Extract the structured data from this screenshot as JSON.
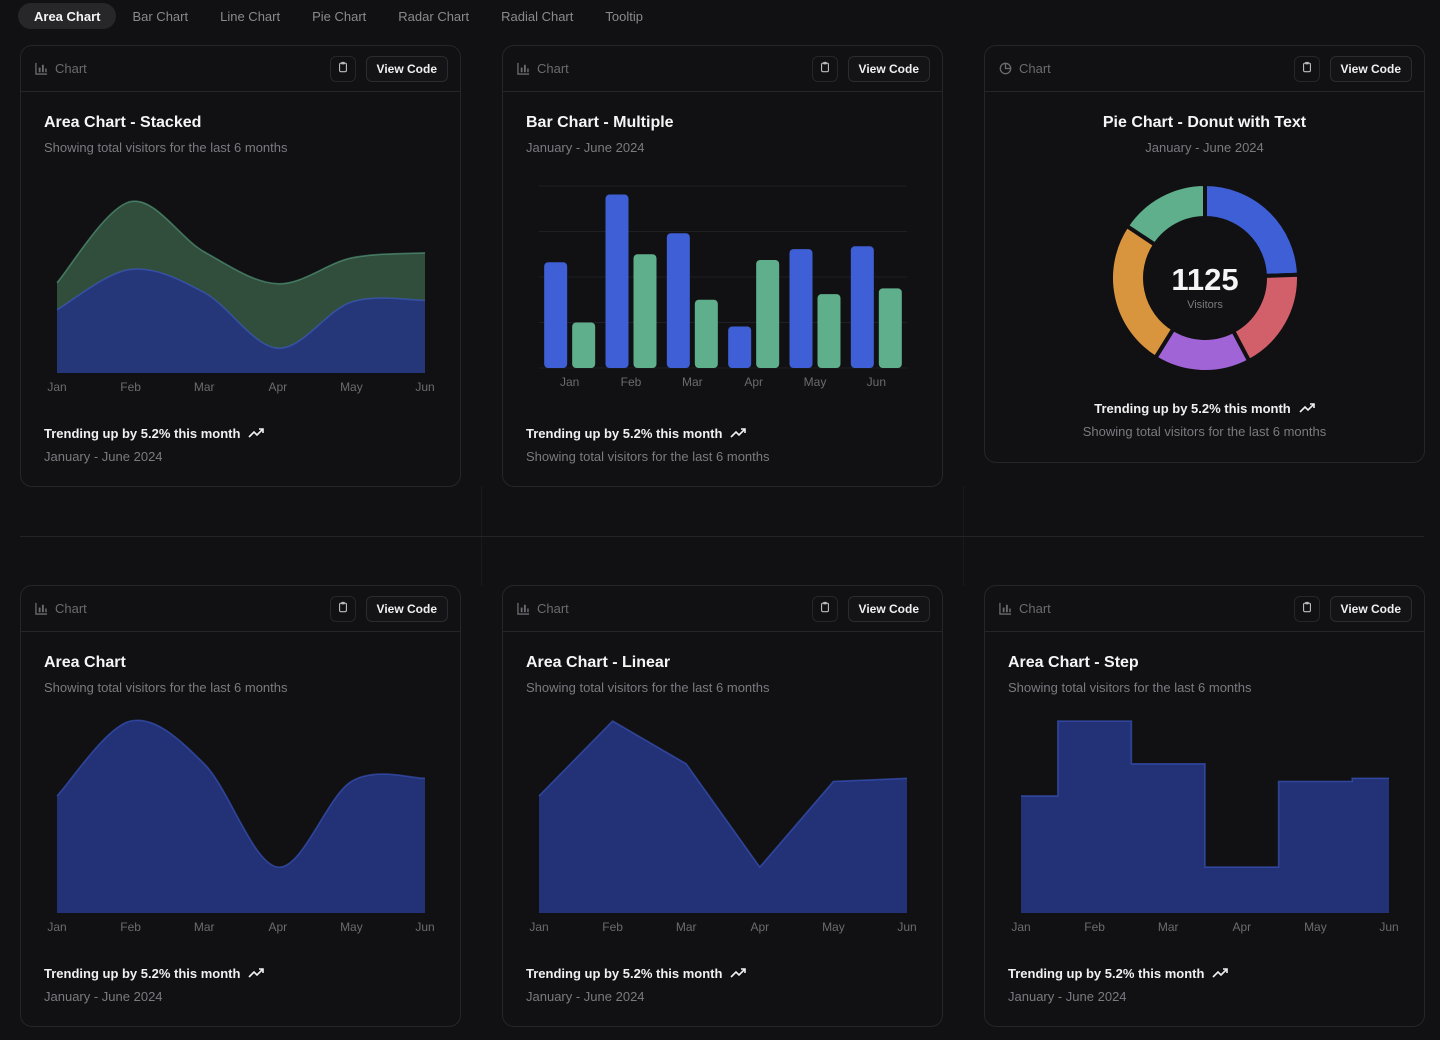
{
  "tabs": [
    "Area Chart",
    "Bar Chart",
    "Line Chart",
    "Pie Chart",
    "Radar Chart",
    "Radial Chart",
    "Tooltip"
  ],
  "active_tab": "Area Chart",
  "colors": {
    "blue": "#3f5fd6",
    "blue_fill": "#24347a",
    "green": "#5fae8c",
    "green_fill": "#33503f",
    "red": "#d2606b",
    "purple": "#a064d6",
    "orange": "#d9953e",
    "teal": "#5fae8c"
  },
  "cards": [
    {
      "toolbar": {
        "label": "Chart",
        "icon": "bar-chart-icon",
        "view_code": "View Code"
      },
      "title": "Area Chart - Stacked",
      "subtitle": "Showing total visitors for the last 6 months",
      "footer": {
        "trend": "Trending up by 5.2% this month",
        "sub": "January - June 2024"
      }
    },
    {
      "toolbar": {
        "label": "Chart",
        "icon": "bar-chart-icon",
        "view_code": "View Code"
      },
      "title": "Bar Chart - Multiple",
      "subtitle": "January - June 2024",
      "footer": {
        "trend": "Trending up by 5.2% this month",
        "sub": "Showing total visitors for the last 6 months"
      }
    },
    {
      "toolbar": {
        "label": "Chart",
        "icon": "pie-chart-icon",
        "view_code": "View Code"
      },
      "title": "Pie Chart - Donut with Text",
      "subtitle": "January - June 2024",
      "center_value": "1125",
      "center_label": "Visitors",
      "footer": {
        "trend": "Trending up by 5.2% this month",
        "sub": "Showing total visitors for the last 6 months"
      }
    },
    {
      "toolbar": {
        "label": "Chart",
        "icon": "bar-chart-icon",
        "view_code": "View Code"
      },
      "title": "Area Chart",
      "subtitle": "Showing total visitors for the last 6 months",
      "footer": {
        "trend": "Trending up by 5.2% this month",
        "sub": "January - June 2024"
      }
    },
    {
      "toolbar": {
        "label": "Chart",
        "icon": "bar-chart-icon",
        "view_code": "View Code"
      },
      "title": "Area Chart - Linear",
      "subtitle": "Showing total visitors for the last 6 months",
      "footer": {
        "trend": "Trending up by 5.2% this month",
        "sub": "January - June 2024"
      }
    },
    {
      "toolbar": {
        "label": "Chart",
        "icon": "bar-chart-icon",
        "view_code": "View Code"
      },
      "title": "Area Chart - Step",
      "subtitle": "Showing total visitors for the last 6 months",
      "footer": {
        "trend": "Trending up by 5.2% this month",
        "sub": "January - June 2024"
      }
    }
  ],
  "chart_data": [
    {
      "type": "area",
      "stacked": true,
      "curve": "natural",
      "categories": [
        "Jan",
        "Feb",
        "Mar",
        "Apr",
        "May",
        "Jun"
      ],
      "series": [
        {
          "values": [
            186,
            305,
            237,
            73,
            209,
            214
          ],
          "color": "#3f5fd6"
        },
        {
          "values": [
            80,
            200,
            120,
            190,
            130,
            140
          ],
          "color": "#5fae8c"
        }
      ]
    },
    {
      "type": "bar",
      "categories": [
        "Jan",
        "Feb",
        "Mar",
        "Apr",
        "May",
        "Jun"
      ],
      "series": [
        {
          "values": [
            186,
            305,
            237,
            73,
            209,
            214
          ],
          "color": "#3f5fd6"
        },
        {
          "values": [
            80,
            200,
            120,
            190,
            130,
            140
          ],
          "color": "#5fae8c"
        }
      ],
      "ylim": [
        0,
        320
      ],
      "grid": true
    },
    {
      "type": "pie",
      "donut": true,
      "slices": [
        {
          "value": 275,
          "color": "#3f5fd6"
        },
        {
          "value": 200,
          "color": "#d2606b"
        },
        {
          "value": 187,
          "color": "#a064d6"
        },
        {
          "value": 287,
          "color": "#d9953e"
        },
        {
          "value": 176,
          "color": "#5fae8c"
        }
      ],
      "total": 1125
    },
    {
      "type": "area",
      "curve": "natural",
      "categories": [
        "Jan",
        "Feb",
        "Mar",
        "Apr",
        "May",
        "Jun"
      ],
      "series": [
        {
          "values": [
            186,
            305,
            237,
            73,
            209,
            214
          ],
          "color": "#3f5fd6"
        }
      ]
    },
    {
      "type": "area",
      "curve": "linear",
      "categories": [
        "Jan",
        "Feb",
        "Mar",
        "Apr",
        "May",
        "Jun"
      ],
      "series": [
        {
          "values": [
            186,
            305,
            237,
            73,
            209,
            214
          ],
          "color": "#3f5fd6"
        }
      ]
    },
    {
      "type": "area",
      "curve": "step",
      "categories": [
        "Jan",
        "Feb",
        "Mar",
        "Apr",
        "May",
        "Jun"
      ],
      "series": [
        {
          "values": [
            186,
            305,
            237,
            73,
            209,
            214
          ],
          "color": "#3f5fd6"
        }
      ]
    }
  ]
}
